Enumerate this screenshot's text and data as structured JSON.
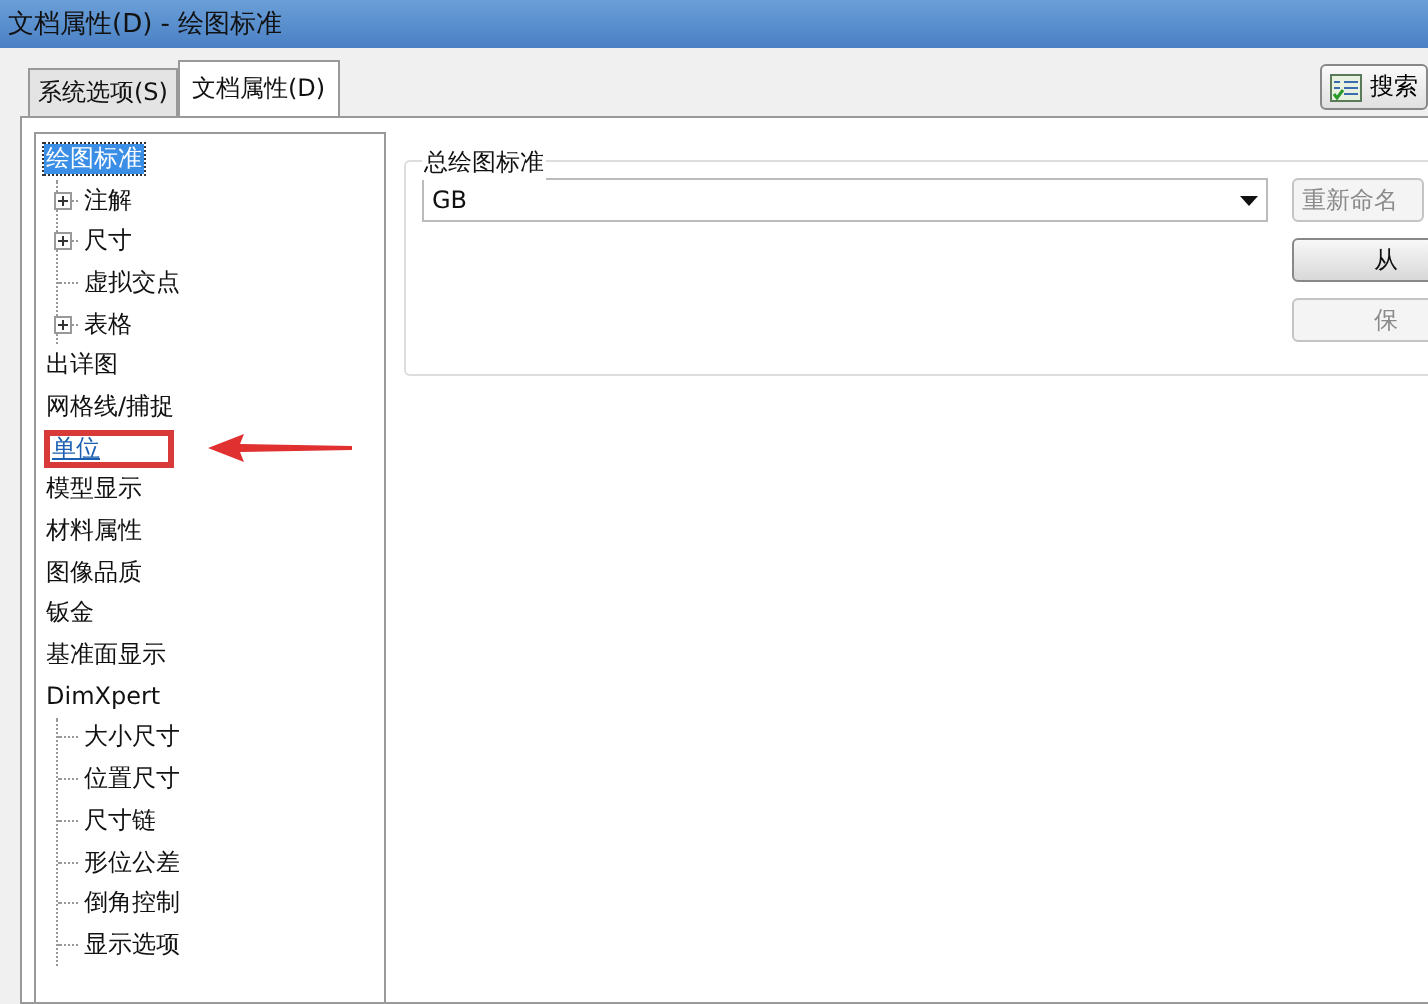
{
  "window": {
    "title": "文档属性(D) - 绘图标准"
  },
  "tabs": [
    {
      "label": "系统选项(S)",
      "selected": false
    },
    {
      "label": "文档属性(D)",
      "selected": true
    }
  ],
  "search_button": {
    "label": "搜索"
  },
  "tree": [
    {
      "label": "绘图标准",
      "selected": true,
      "expander": false,
      "link": false,
      "annotated": false,
      "children": [
        {
          "label": "注解",
          "selected": false,
          "expander": true,
          "link": false,
          "annotated": false
        },
        {
          "label": "尺寸",
          "selected": false,
          "expander": true,
          "link": false,
          "annotated": false
        },
        {
          "label": "虚拟交点",
          "selected": false,
          "expander": false,
          "link": false,
          "annotated": false
        },
        {
          "label": "表格",
          "selected": false,
          "expander": true,
          "link": false,
          "annotated": false
        }
      ]
    },
    {
      "label": "出详图",
      "selected": false,
      "expander": false,
      "link": false,
      "annotated": false
    },
    {
      "label": "网格线/捕捉",
      "selected": false,
      "expander": false,
      "link": false,
      "annotated": false
    },
    {
      "label": "单位",
      "selected": false,
      "expander": false,
      "link": true,
      "annotated": true
    },
    {
      "label": "模型显示",
      "selected": false,
      "expander": false,
      "link": false,
      "annotated": false
    },
    {
      "label": "材料属性",
      "selected": false,
      "expander": false,
      "link": false,
      "annotated": false
    },
    {
      "label": "图像品质",
      "selected": false,
      "expander": false,
      "link": false,
      "annotated": false
    },
    {
      "label": "钣金",
      "selected": false,
      "expander": false,
      "link": false,
      "annotated": false
    },
    {
      "label": "基准面显示",
      "selected": false,
      "expander": false,
      "link": false,
      "annotated": false
    },
    {
      "label": "DimXpert",
      "selected": false,
      "expander": false,
      "link": false,
      "annotated": false,
      "children": [
        {
          "label": "大小尺寸",
          "selected": false,
          "expander": false,
          "link": false,
          "annotated": false
        },
        {
          "label": "位置尺寸",
          "selected": false,
          "expander": false,
          "link": false,
          "annotated": false
        },
        {
          "label": "尺寸链",
          "selected": false,
          "expander": false,
          "link": false,
          "annotated": false
        },
        {
          "label": "形位公差",
          "selected": false,
          "expander": false,
          "link": false,
          "annotated": false
        },
        {
          "label": "倒角控制",
          "selected": false,
          "expander": false,
          "link": false,
          "annotated": false
        },
        {
          "label": "显示选项",
          "selected": false,
          "expander": false,
          "link": false,
          "annotated": false
        }
      ]
    }
  ],
  "group": {
    "title": "总绘图标准",
    "combo_value": "GB",
    "buttons": [
      {
        "label": "重新命名",
        "disabled": true
      },
      {
        "label": "从",
        "disabled": false
      },
      {
        "label": "保",
        "disabled": true
      }
    ]
  }
}
